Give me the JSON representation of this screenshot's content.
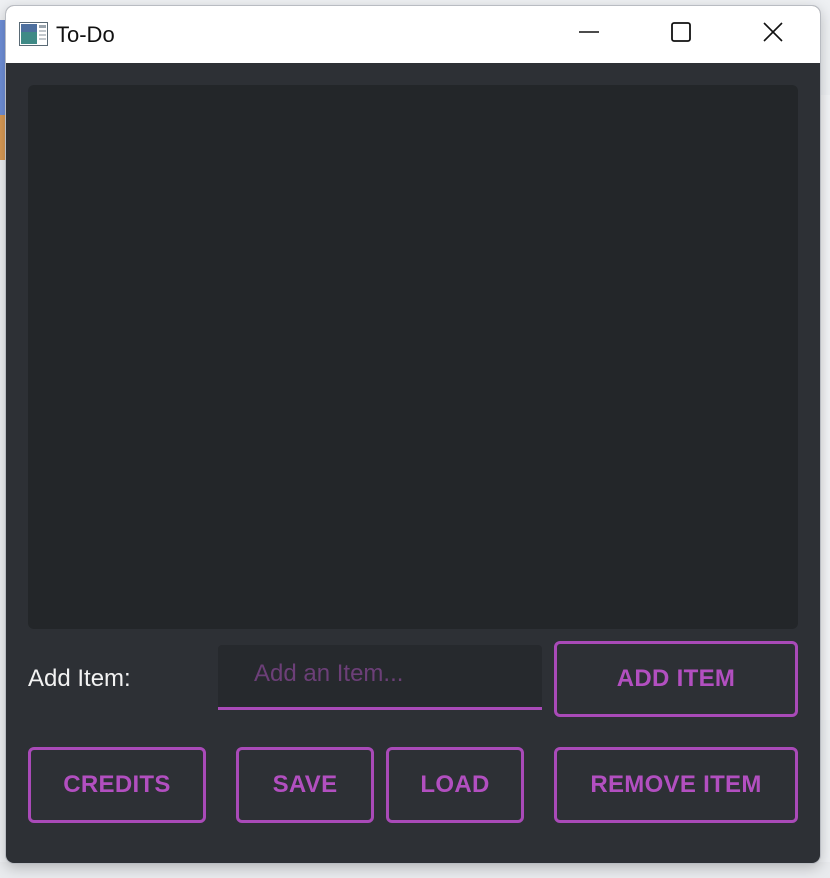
{
  "window": {
    "title": "To-Do",
    "app_icon": "app-window-icon"
  },
  "titlebar_controls": {
    "minimize_icon": "minimize-icon",
    "maximize_icon": "maximize-icon",
    "close_icon": "close-icon"
  },
  "todo_list": {
    "items": []
  },
  "add_item": {
    "label": "Add Item:",
    "input_value": "",
    "placeholder": "Add an Item...",
    "button_label": "ADD ITEM"
  },
  "actions": {
    "credits_label": "CREDITS",
    "save_label": "SAVE",
    "load_label": "LOAD",
    "remove_label": "REMOVE ITEM"
  },
  "colors": {
    "accent": "#a94ab8",
    "window_background": "#2d3035",
    "list_background": "#232629",
    "titlebar_background": "#ffffff"
  }
}
